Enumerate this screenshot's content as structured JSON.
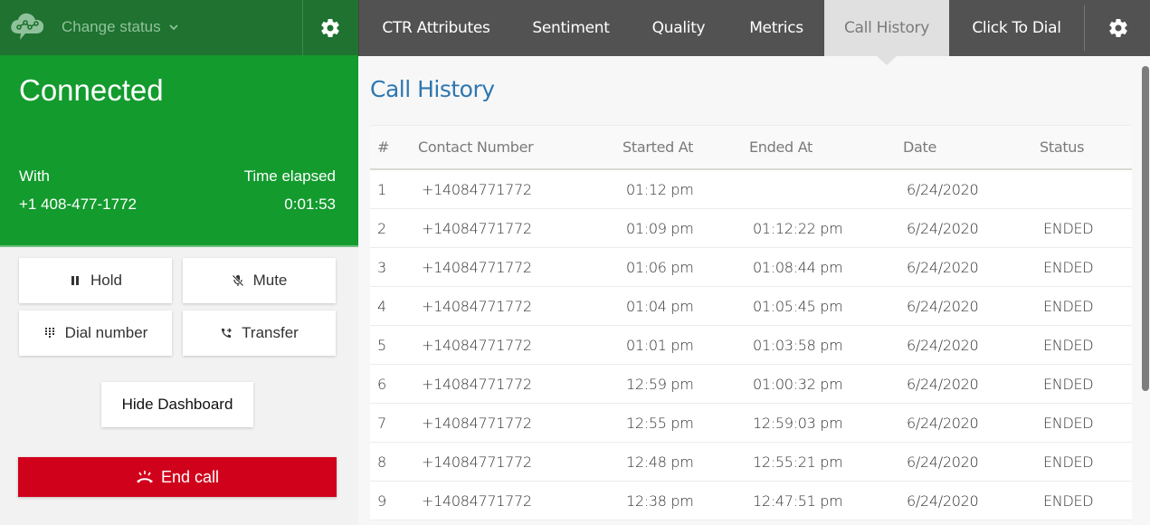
{
  "left_header": {
    "logo_icon": "cloud-chat-logo-icon",
    "status_label": "Change status",
    "status_icon": "chevron-down-icon",
    "settings_icon": "gear-icon"
  },
  "connection": {
    "state": "Connected",
    "with_label": "With",
    "with_number": "+1 408-477-1772",
    "time_label": "Time elapsed",
    "time_value": "0:01:53"
  },
  "controls": {
    "hold": "Hold",
    "mute": "Mute",
    "dial": "Dial number",
    "transfer": "Transfer",
    "hide_dashboard": "Hide Dashboard",
    "end_call": "End call"
  },
  "tabs": [
    {
      "label": "CTR Attributes"
    },
    {
      "label": "Sentiment"
    },
    {
      "label": "Quality"
    },
    {
      "label": "Metrics"
    },
    {
      "label": "Call History",
      "active": true
    },
    {
      "label": "Click To Dial"
    }
  ],
  "colors": {
    "header_green": "#1f7230",
    "connected_green": "#139b2e",
    "end_call_red": "#d0021b",
    "tab_bar": "#525252",
    "title_blue": "#2e77b0"
  },
  "call_history": {
    "title": "Call History",
    "columns": [
      "#",
      "Contact Number",
      "Started At",
      "Ended At",
      "Date",
      "Status"
    ],
    "rows": [
      [
        "1",
        "+14084771772",
        "01:12 pm",
        "",
        "6/24/2020",
        ""
      ],
      [
        "2",
        "+14084771772",
        "01:09 pm",
        "01:12:22 pm",
        "6/24/2020",
        "ENDED"
      ],
      [
        "3",
        "+14084771772",
        "01:06 pm",
        "01:08:44 pm",
        "6/24/2020",
        "ENDED"
      ],
      [
        "4",
        "+14084771772",
        "01:04 pm",
        "01:05:45 pm",
        "6/24/2020",
        "ENDED"
      ],
      [
        "5",
        "+14084771772",
        "01:01 pm",
        "01:03:58 pm",
        "6/24/2020",
        "ENDED"
      ],
      [
        "6",
        "+14084771772",
        "12:59 pm",
        "01:00:32 pm",
        "6/24/2020",
        "ENDED"
      ],
      [
        "7",
        "+14084771772",
        "12:55 pm",
        "12:59:03 pm",
        "6/24/2020",
        "ENDED"
      ],
      [
        "8",
        "+14084771772",
        "12:48 pm",
        "12:55:21 pm",
        "6/24/2020",
        "ENDED"
      ],
      [
        "9",
        "+14084771772",
        "12:38 pm",
        "12:47:51 pm",
        "6/24/2020",
        "ENDED"
      ]
    ]
  }
}
